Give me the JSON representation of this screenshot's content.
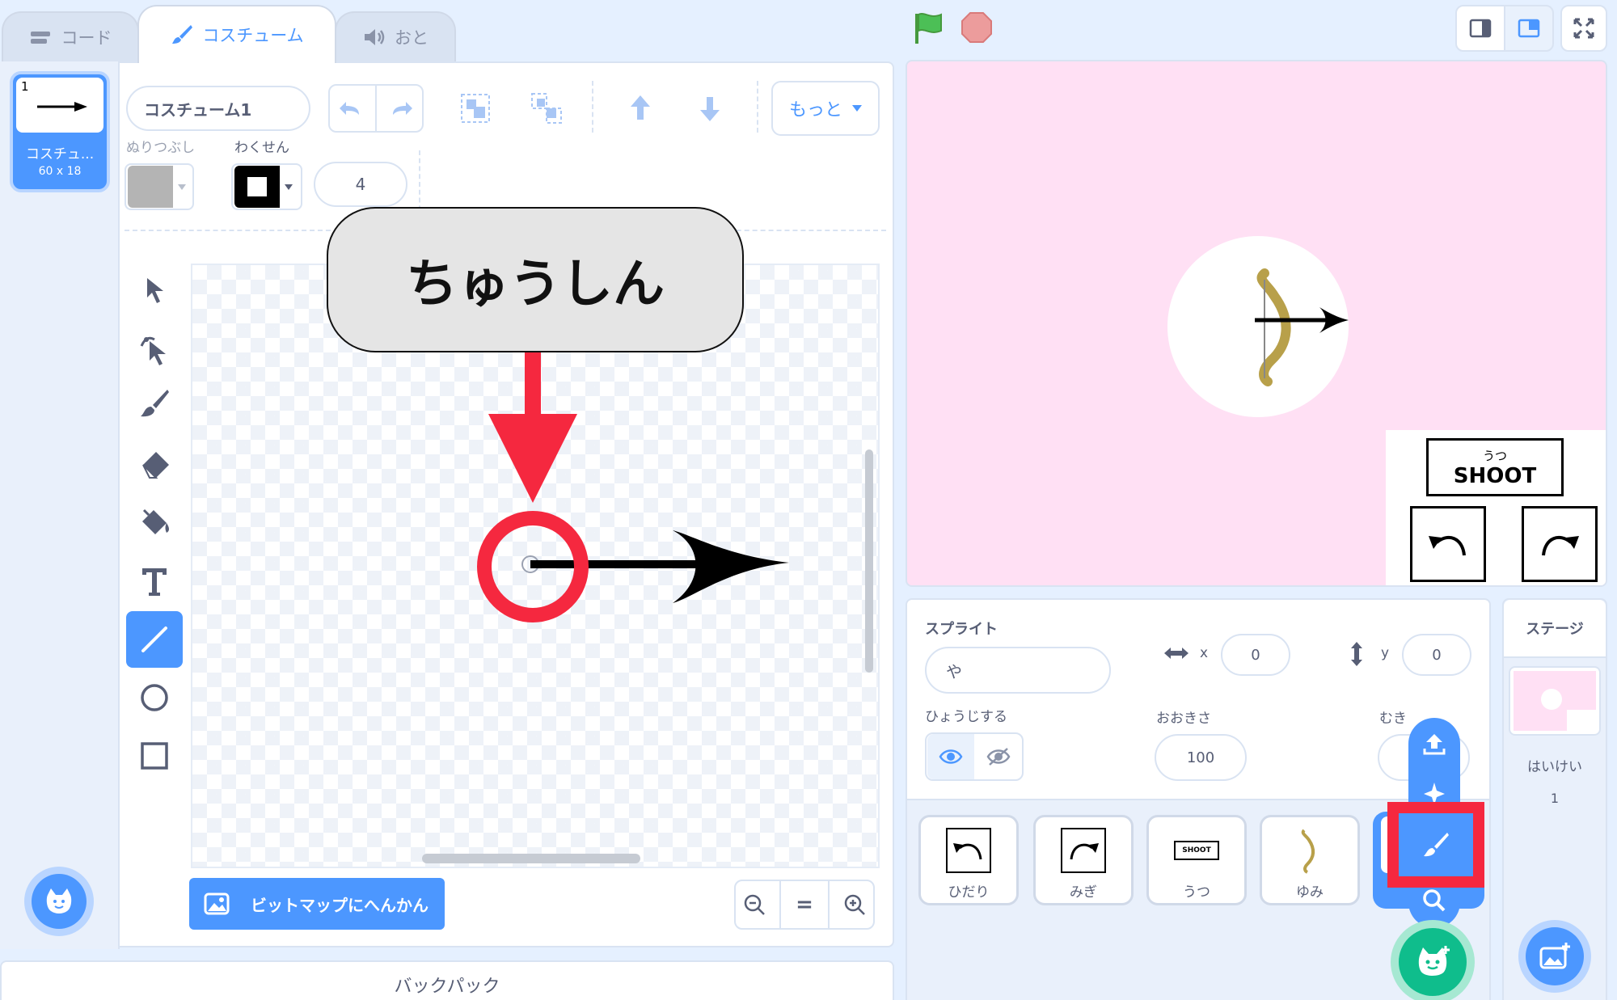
{
  "tabs": [
    {
      "label": "コード",
      "icon": "code-icon"
    },
    {
      "label": "コスチューム",
      "icon": "brush-icon"
    },
    {
      "label": "おと",
      "icon": "speaker-icon"
    }
  ],
  "costume_list": [
    {
      "number": "1",
      "name": "コスチュ...",
      "size": "60 x 18"
    }
  ],
  "editor": {
    "costume_name": "コスチューム1",
    "more_label": "もっと",
    "fill_label": "ぬりつぶし",
    "outline_label": "わくせん",
    "outline_width": "4",
    "convert_button": "ビットマップにへんかん",
    "zoom_reset": "="
  },
  "callout": {
    "text": "ちゅうしん"
  },
  "stage": {
    "shoot_small": "うつ",
    "shoot_label": "SHOOT"
  },
  "sprite_info": {
    "section_label": "スプライト",
    "name": "や",
    "x_label": "x",
    "x_value": "0",
    "y_label": "y",
    "y_value": "0",
    "show_label": "ひょうじする",
    "size_label": "おおきさ",
    "size_value": "100",
    "direction_label": "むき"
  },
  "sprites": [
    {
      "name": "ひだり"
    },
    {
      "name": "みぎ"
    },
    {
      "name": "うつ",
      "thumb_text": "SHOOT"
    },
    {
      "name": "ゆみ"
    }
  ],
  "stage_pane": {
    "title": "ステージ",
    "backdrop_label": "はいけい",
    "backdrop_count": "1"
  },
  "backpack": {
    "label": "バックパック"
  },
  "colors": {
    "accent": "#4c97ff",
    "stage_bg": "#ffe0f4",
    "highlight": "#e8263f",
    "green_button": "#0fbd8c",
    "flag": "#4cbf56",
    "stop": "#ec9c9c",
    "bow": "#b8a04a"
  }
}
